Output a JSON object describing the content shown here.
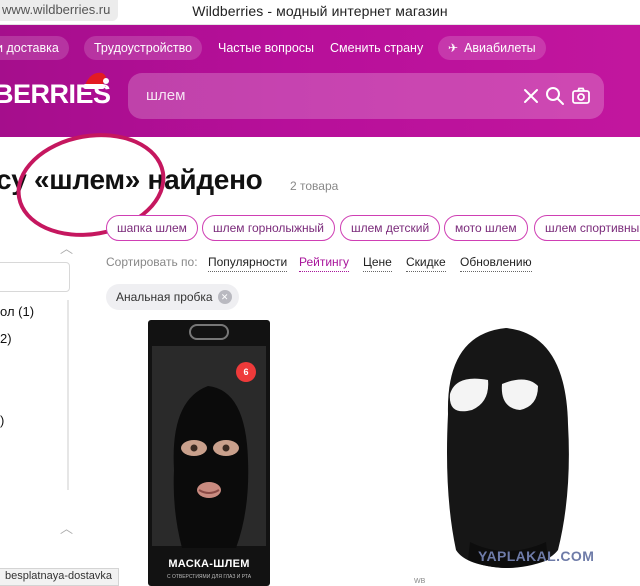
{
  "browser": {
    "url": "www.wildberries.ru",
    "window_title": "Wildberries - модный интернет магазин"
  },
  "header": {
    "nav": [
      {
        "label": "и доставка"
      },
      {
        "label": "Трудоустройство"
      },
      {
        "label": "Частые вопросы"
      },
      {
        "label": "Сменить страну"
      },
      {
        "label": "Авиабилеты"
      }
    ],
    "logo": "BERRIES",
    "search": {
      "value": "шлем",
      "clear_icon": "close-icon",
      "search_icon": "search-icon",
      "camera_icon": "camera-icon"
    },
    "colors": {
      "header_start": "#a50e8c",
      "header_end": "#c2169e",
      "accent": "#a8149b"
    }
  },
  "results": {
    "title": "су «шлем» найдено",
    "count": "2 товара"
  },
  "sidebar": {
    "items": [
      {
        "label": "ол (1)"
      },
      {
        "label": "2)"
      },
      {
        "label": ")"
      }
    ]
  },
  "tags": [
    {
      "label": "шапка шлем"
    },
    {
      "label": "шлем горнолыжный"
    },
    {
      "label": "шлем детский"
    },
    {
      "label": "мото шлем"
    },
    {
      "label": "шлем спортивный"
    }
  ],
  "sorting": {
    "label": "Сортировать по:",
    "options": [
      {
        "label": "Популярности"
      },
      {
        "label": "Рейтингу",
        "active": true
      },
      {
        "label": "Цене"
      },
      {
        "label": "Скидке"
      },
      {
        "label": "Обновлению"
      }
    ]
  },
  "active_filter": {
    "label": "Анальная пробка"
  },
  "products": [
    {
      "package_label": "МАСКА-ШЛЕМ",
      "package_sub": "С ОТВЕРСТИЯМИ ДЛЯ ГЛАЗ И РТА",
      "badge": "6"
    },
    {
      "brand_mark": "WB"
    }
  ],
  "status_url": "besplatnaya-dostavka",
  "watermark": "YAPLAKAL.COM"
}
